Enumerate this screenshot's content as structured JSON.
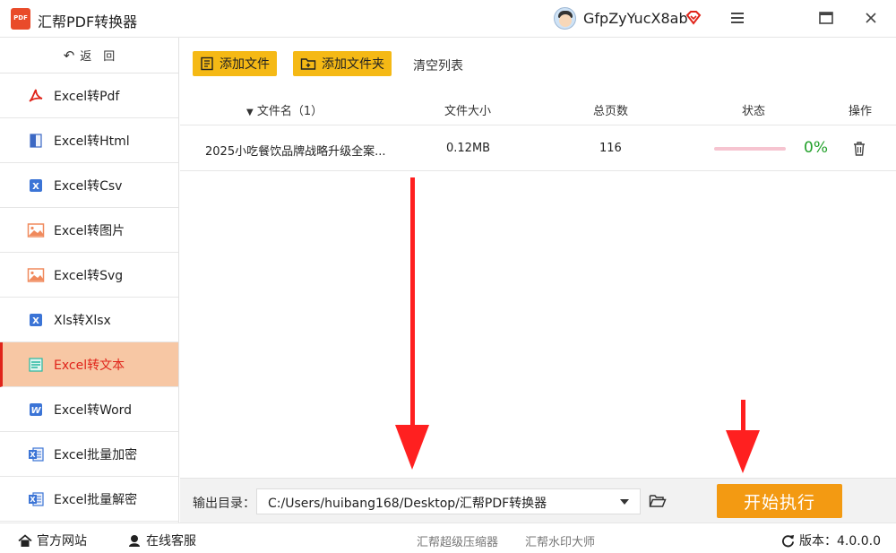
{
  "app": {
    "title": "汇帮PDF转换器",
    "logo_text": "PDF"
  },
  "user": {
    "name": "GfpZyYucX8ab"
  },
  "sidebar": {
    "back_label": "返　回",
    "items": [
      {
        "label": "Excel转Pdf",
        "icon": "pdf-icon",
        "color": "#e0241a"
      },
      {
        "label": "Excel转Html",
        "icon": "html-file-icon",
        "color": "#3b68c4"
      },
      {
        "label": "Excel转Csv",
        "icon": "excel-x-icon",
        "color": "#3b74d6"
      },
      {
        "label": "Excel转图片",
        "icon": "image-icon",
        "color": "#f08a5d"
      },
      {
        "label": "Excel转Svg",
        "icon": "image-icon",
        "color": "#f08a5d"
      },
      {
        "label": "Xls转Xlsx",
        "icon": "excel-x-icon",
        "color": "#3b74d6"
      },
      {
        "label": "Excel转文本",
        "icon": "text-file-icon",
        "color": "#27b8a0",
        "active": true
      },
      {
        "label": "Excel转Word",
        "icon": "word-icon",
        "color": "#3b74d6"
      },
      {
        "label": "Excel批量加密",
        "icon": "excel-doc-icon",
        "color": "#3b74d6"
      },
      {
        "label": "Excel批量解密",
        "icon": "excel-doc-icon",
        "color": "#3b74d6"
      }
    ]
  },
  "toolbar": {
    "add_file": "添加文件",
    "add_folder": "添加文件夹",
    "clear": "清空列表"
  },
  "table": {
    "headers": {
      "name": "文件名（1）",
      "size": "文件大小",
      "pages": "总页数",
      "status": "状态",
      "action": "操作"
    },
    "rows": [
      {
        "name": "2025小吃餐饮品牌战略升级全案...",
        "size": "0.12MB",
        "pages": "116",
        "progress_percent": 0,
        "progress_text": "0%"
      }
    ]
  },
  "output": {
    "label": "输出目录：",
    "path": "C:/Users/huibang168/Desktop/汇帮PDF转换器",
    "start_label": "开始执行"
  },
  "footer": {
    "website": "官方网站",
    "service": "在线客服",
    "link1": "汇帮超级压缩器",
    "link2": "汇帮水印大师",
    "version": "版本：4.0.0.0"
  },
  "colors": {
    "accent_yellow": "#f5b915",
    "start_orange": "#f39a12",
    "active_bg": "#f7c7a4",
    "active_text": "#e0241a",
    "progress_green": "#22a02a"
  }
}
